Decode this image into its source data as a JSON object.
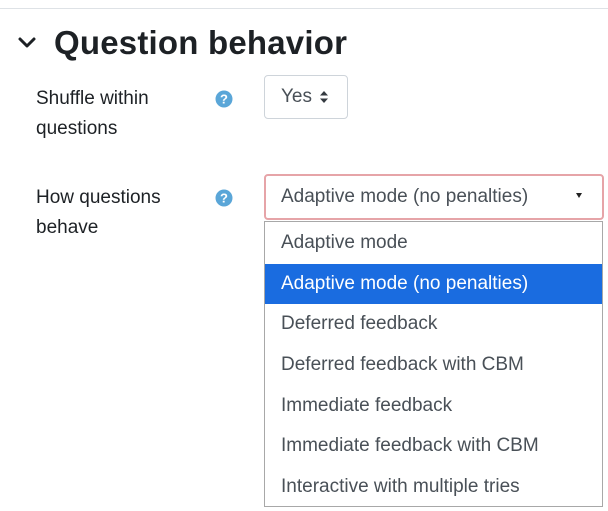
{
  "section": {
    "title": "Question behavior",
    "chevron_icon": "chevron-down-icon"
  },
  "fields": {
    "shuffle": {
      "label_line1": "Shuffle within",
      "label_line2": "questions",
      "help_icon": "question-circle-icon",
      "value": "Yes"
    },
    "behaviour": {
      "label_line1": "How questions",
      "label_line2": "behave",
      "help_icon": "question-circle-icon",
      "value": "Adaptive mode (no penalties)"
    }
  },
  "dropdown": {
    "options": [
      {
        "label": "Adaptive mode"
      },
      {
        "label": "Adaptive mode (no penalties)",
        "selected": true
      },
      {
        "label": "Deferred feedback"
      },
      {
        "label": "Deferred feedback with CBM"
      },
      {
        "label": "Immediate feedback"
      },
      {
        "label": "Immediate feedback with CBM"
      },
      {
        "label": "Interactive with multiple tries"
      }
    ]
  },
  "colors": {
    "help_icon": "#5aa6d8",
    "selected_option_bg": "#1a6ce0",
    "focus_border": "#e6a4a8"
  }
}
